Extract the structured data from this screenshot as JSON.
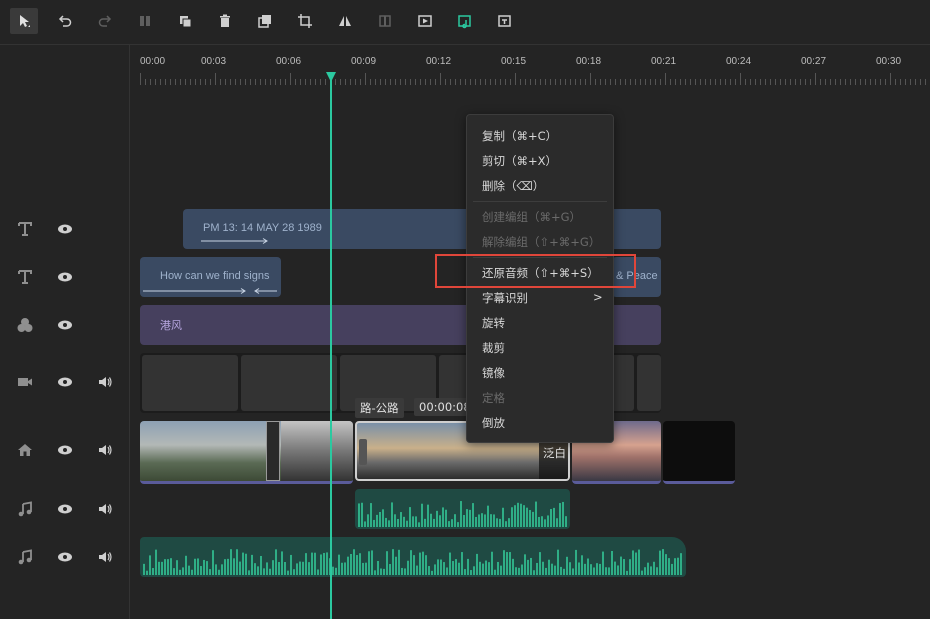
{
  "toolbar": {
    "buttons": [
      "select-tool",
      "undo",
      "redo",
      "split",
      "copy",
      "delete",
      "group",
      "crop",
      "mirror",
      "freeze",
      "play-clip",
      "audio-restore",
      "subtitle"
    ],
    "accent": "#2bc9a0"
  },
  "ruler": {
    "ticks": [
      "00:00",
      "00:03",
      "00:06",
      "00:09",
      "00:12",
      "00:15",
      "00:18",
      "00:21",
      "00:24",
      "00:27",
      "00:30"
    ]
  },
  "tracks": [
    {
      "type": "text",
      "icon": "text-icon"
    },
    {
      "type": "text",
      "icon": "text-icon"
    },
    {
      "type": "effect",
      "icon": "effect-icon"
    },
    {
      "type": "video",
      "icon": "camera-icon"
    },
    {
      "type": "main",
      "icon": "home-icon"
    },
    {
      "type": "audio",
      "icon": "music-note-icon"
    },
    {
      "type": "audio",
      "icon": "music-note-icon"
    }
  ],
  "clips": {
    "text1": "PM  13: 14 MAY  28  1989",
    "text2": "How can we find signs",
    "text2_tail": "& Peace",
    "effect": "港风",
    "hover_name": "路-公路",
    "hover_time": "00:00:08",
    "transition": "泛白"
  },
  "menu": {
    "items": [
      {
        "label": "复制（⌘+C）",
        "enabled": true
      },
      {
        "label": "剪切（⌘+X）",
        "enabled": true
      },
      {
        "label": "删除（⌫）",
        "enabled": true
      },
      {
        "label": "创建编组（⌘+G）",
        "enabled": false
      },
      {
        "label": "解除编组（⇧+⌘+G）",
        "enabled": false
      },
      {
        "label": "还原音频（⇧+⌘+S）",
        "enabled": true
      },
      {
        "label": "字幕识别",
        "enabled": true,
        "submenu_arrow": ">"
      },
      {
        "label": "旋转",
        "enabled": true
      },
      {
        "label": "裁剪",
        "enabled": true
      },
      {
        "label": "镜像",
        "enabled": true
      },
      {
        "label": "定格",
        "enabled": false
      },
      {
        "label": "倒放",
        "enabled": true
      }
    ]
  }
}
